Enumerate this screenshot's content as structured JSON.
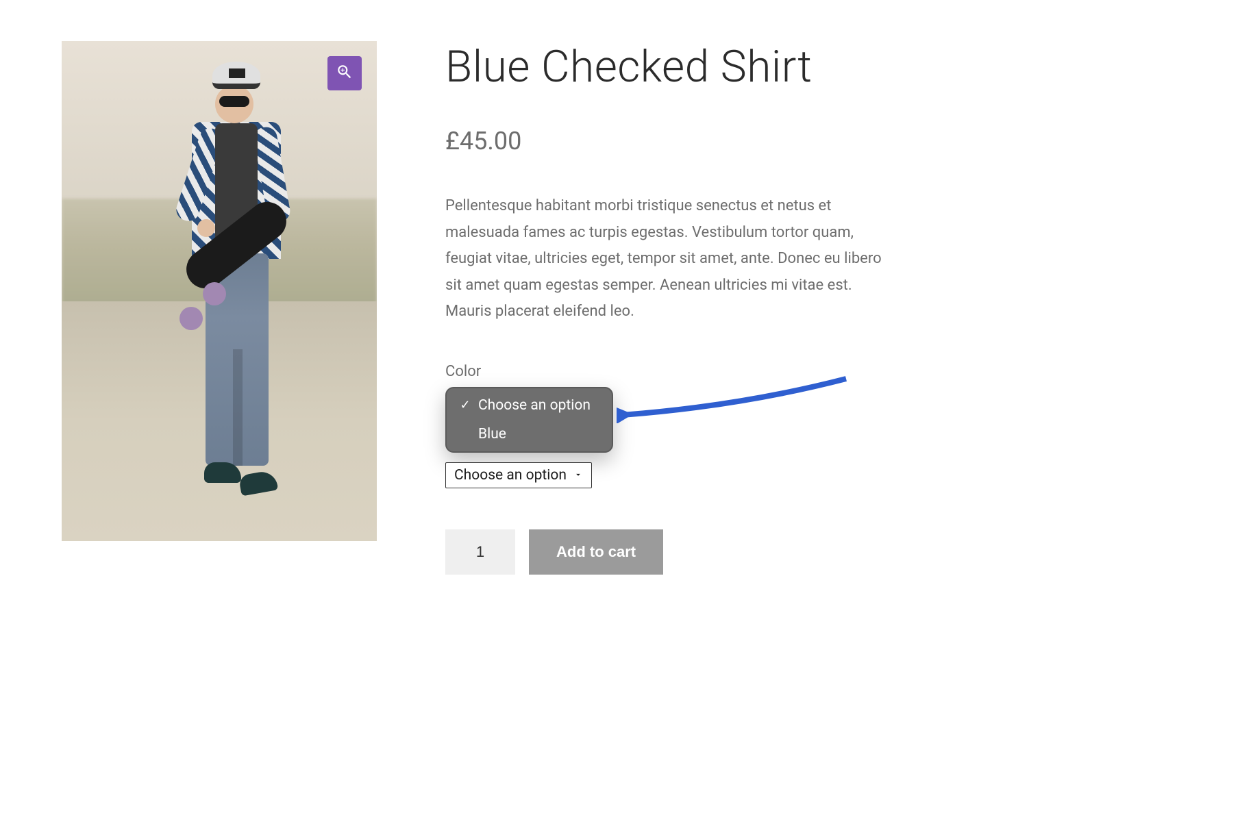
{
  "product": {
    "title": "Blue Checked Shirt",
    "price": "£45.00",
    "description": "Pellentesque habitant morbi tristique senectus et netus et malesuada fames ac turpis egestas. Vestibulum tortor quam, feugiat vitae, ultricies eget, tempor sit amet, ante. Donec eu libero sit amet quam egestas semper. Aenean ultricies mi vitae est. Mauris placerat eleifend leo."
  },
  "variation": {
    "label": "Color",
    "placeholder": "Choose an option",
    "options": [
      "Choose an option",
      "Blue"
    ],
    "selected": "Choose an option"
  },
  "cart": {
    "quantity": "1",
    "add_label": "Add to cart"
  },
  "colors": {
    "accent": "#7f54b3",
    "annotation": "#2f5fd0"
  }
}
